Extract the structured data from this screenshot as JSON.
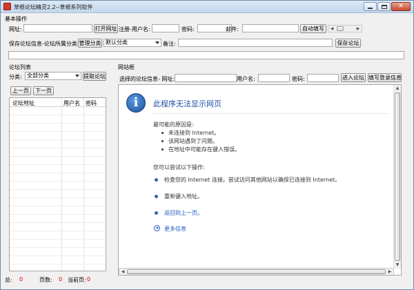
{
  "window": {
    "title": "草根论坛精灵2.2--草根系列软件"
  },
  "basic": {
    "section_title": "基本操作",
    "url_label": "网址:",
    "open_url_button": "打开网址",
    "register_username_label": "注册-用户名:",
    "password_label": "密码:",
    "email_label": "邮件:",
    "auto_fill_button": "自动填写"
  },
  "save": {
    "label": "保存论坛信息-论坛所属分类:",
    "manage_button": "管理分类",
    "category_value": "默认分类",
    "note_label": "备注:",
    "save_button": "保存论坛"
  },
  "forum_list": {
    "title": "论坛列表",
    "category_label": "分类:",
    "category_value": "全部分类",
    "fetch_button": "提取论坛",
    "prev_button": "上一页",
    "next_button": "下一页",
    "columns": [
      "论坛地址",
      "用户名",
      "密码"
    ]
  },
  "footer": {
    "total_label": "总:",
    "total_value": "0",
    "pages_label": "页数:",
    "pages_value": "0",
    "current_label": "当前页:",
    "current_value": "0"
  },
  "site_box": {
    "title": "网站框",
    "selected_label": "选择的论坛信息- 网址:",
    "username_label": "用户名:",
    "password_label": "密码:",
    "enter_button": "进入论坛",
    "fill_login_button": "填写登录信息"
  },
  "browser": {
    "error_title": "此程序无法显示网页",
    "reasons_heading": "最可能的原因是:",
    "reasons": [
      "未连接到 Internet。",
      "该网站遇到了问题。",
      "在地址中可能存在键入错误。"
    ],
    "try_heading": "您可以尝试以下操作:",
    "actions": [
      "检查您的 Internet 连接。尝试访问其他网站以确保已连接到 Internet。",
      "重新键入地址。",
      "返回到上一页。"
    ],
    "more_info": "更多信息"
  },
  "colors": {
    "accent": "#1f4ea3",
    "link": "#1f58c2",
    "counter": "#d30000"
  }
}
